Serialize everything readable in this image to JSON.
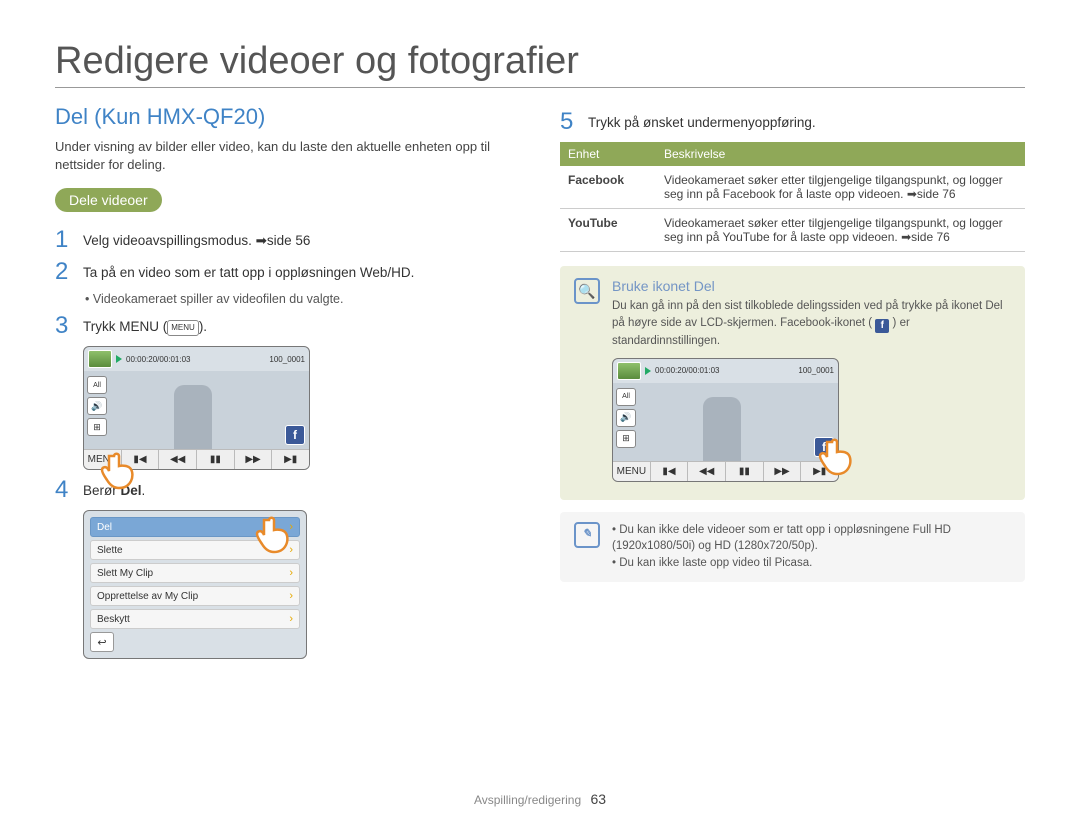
{
  "title": "Redigere videoer og fotografier",
  "section_heading": "Del (Kun HMX-QF20)",
  "intro": "Under visning av bilder eller video, kan du laste den aktuelle enheten opp til nettsider for deling.",
  "pill": "Dele videoer",
  "steps": {
    "s1": {
      "n": "1",
      "text": "Velg videoavspillingsmodus. ➡side 56"
    },
    "s2": {
      "n": "2",
      "text": "Ta på en video som er tatt opp i oppløsningen Web/HD.",
      "bullet": "Videokameraet spiller av videofilen du valgte."
    },
    "s3": {
      "n": "3",
      "pre": "Trykk MENU (",
      "post": ")."
    },
    "s4": {
      "n": "4",
      "pre": "Berør ",
      "bold": "Del",
      "post": "."
    },
    "s5": {
      "n": "5",
      "text": "Trykk på ønsket undermenyoppføring."
    }
  },
  "menu_chip": "MENU",
  "camera": {
    "time": "00:00:20/00:01:03",
    "clip": "100_0001",
    "all": "All",
    "buttons": [
      "MENU",
      "▮◀",
      "◀◀",
      "▮▮",
      "▶▶",
      "▶▮"
    ]
  },
  "menu_items": [
    "Del",
    "Slette",
    "Slett My Clip",
    "Opprettelse av My Clip",
    "Beskytt"
  ],
  "table": {
    "h1": "Enhet",
    "h2": "Beskrivelse",
    "rows": [
      {
        "k": "Facebook",
        "v": "Videokameraet søker etter tilgjengelige tilgangspunkt, og logger seg inn på Facebook for å laste opp videoen. ➡side 76"
      },
      {
        "k": "YouTube",
        "v": "Videokameraet søker etter tilgjengelige tilgangspunkt, og logger seg inn på YouTube for å laste opp videoen. ➡side 76"
      }
    ]
  },
  "info": {
    "heading": "Bruke ikonet Del",
    "body_pre": "Du kan gå inn på den sist tilkoblede delingssiden ved på trykke på ikonet Del på høyre side av LCD-skjermen. Facebook-ikonet (",
    "body_post": ") er standardinnstillingen."
  },
  "notes": {
    "n1": "Du kan ikke dele videoer som er tatt opp i oppløsningene Full HD (1920x1080/50i) og HD (1280x720/50p).",
    "n2": "Du kan ikke laste opp video til Picasa."
  },
  "footer": {
    "section": "Avspilling/redigering",
    "page": "63"
  }
}
